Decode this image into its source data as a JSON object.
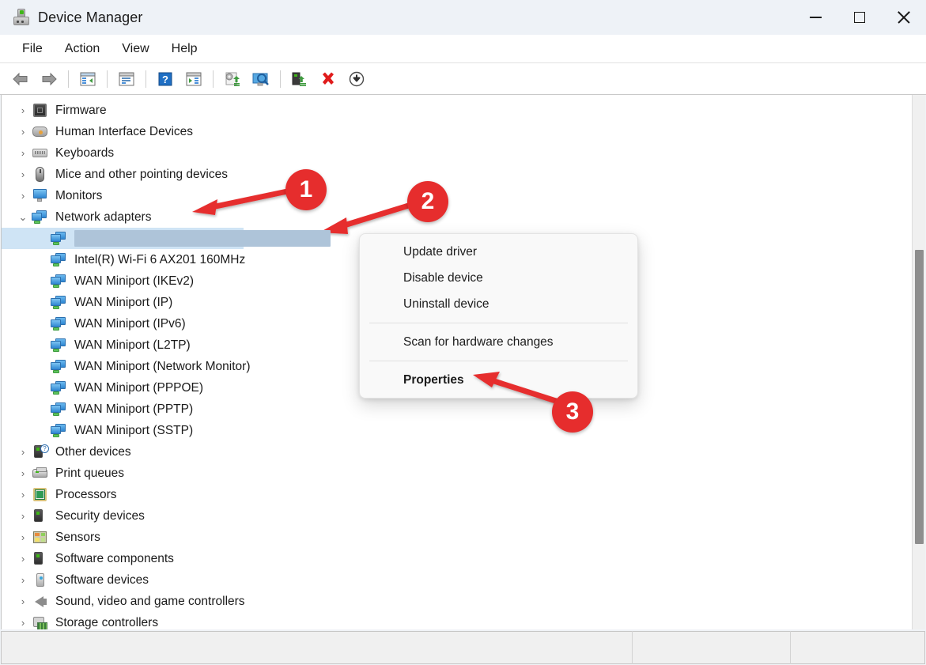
{
  "window": {
    "title": "Device Manager",
    "icon": "device-manager-icon",
    "controls": {
      "minimize": "minimize-button",
      "maximize": "maximize-button",
      "close": "close-button"
    }
  },
  "menubar": {
    "items": [
      {
        "label": "File"
      },
      {
        "label": "Action"
      },
      {
        "label": "View"
      },
      {
        "label": "Help"
      }
    ]
  },
  "toolbar": {
    "buttons": [
      {
        "name": "back-icon"
      },
      {
        "name": "forward-icon"
      },
      {
        "name": "show-hide-console-tree-icon"
      },
      {
        "name": "properties-icon"
      },
      {
        "name": "help-icon"
      },
      {
        "name": "show-hide-action-pane-icon"
      },
      {
        "name": "update-driver-icon"
      },
      {
        "name": "scan-for-hardware-changes-icon"
      },
      {
        "name": "enable-device-icon"
      },
      {
        "name": "uninstall-device-icon"
      },
      {
        "name": "download-icon"
      }
    ]
  },
  "tree": {
    "items": [
      {
        "label": "Firmware",
        "icon": "firmware-icon",
        "level": "category",
        "expanded": false
      },
      {
        "label": "Human Interface Devices",
        "icon": "hid-icon",
        "level": "category",
        "expanded": false
      },
      {
        "label": "Keyboards",
        "icon": "keyboard-icon",
        "level": "category",
        "expanded": false
      },
      {
        "label": "Mice and other pointing devices",
        "icon": "mouse-icon",
        "level": "category",
        "expanded": false
      },
      {
        "label": "Monitors",
        "icon": "monitor-icon",
        "level": "category",
        "expanded": false
      },
      {
        "label": "Network adapters",
        "icon": "network-adapter-icon",
        "level": "category",
        "expanded": true
      },
      {
        "label": "",
        "icon": "network-adapter-icon",
        "level": "child",
        "selected": true,
        "redacted": true
      },
      {
        "label": "Intel(R) Wi-Fi 6 AX201 160MHz",
        "icon": "network-adapter-icon",
        "level": "child"
      },
      {
        "label": "WAN Miniport (IKEv2)",
        "icon": "network-adapter-icon",
        "level": "child"
      },
      {
        "label": "WAN Miniport (IP)",
        "icon": "network-adapter-icon",
        "level": "child"
      },
      {
        "label": "WAN Miniport (IPv6)",
        "icon": "network-adapter-icon",
        "level": "child"
      },
      {
        "label": "WAN Miniport (L2TP)",
        "icon": "network-adapter-icon",
        "level": "child"
      },
      {
        "label": "WAN Miniport (Network Monitor)",
        "icon": "network-adapter-icon",
        "level": "child"
      },
      {
        "label": "WAN Miniport (PPPOE)",
        "icon": "network-adapter-icon",
        "level": "child"
      },
      {
        "label": "WAN Miniport (PPTP)",
        "icon": "network-adapter-icon",
        "level": "child"
      },
      {
        "label": "WAN Miniport (SSTP)",
        "icon": "network-adapter-icon",
        "level": "child"
      },
      {
        "label": "Other devices",
        "icon": "other-devices-icon",
        "level": "category",
        "expanded": false
      },
      {
        "label": "Print queues",
        "icon": "printer-icon",
        "level": "category",
        "expanded": false
      },
      {
        "label": "Processors",
        "icon": "processor-icon",
        "level": "category",
        "expanded": false
      },
      {
        "label": "Security devices",
        "icon": "security-device-icon",
        "level": "category",
        "expanded": false
      },
      {
        "label": "Sensors",
        "icon": "sensor-icon",
        "level": "category",
        "expanded": false
      },
      {
        "label": "Software components",
        "icon": "software-component-icon",
        "level": "category",
        "expanded": false
      },
      {
        "label": "Software devices",
        "icon": "software-device-icon",
        "level": "category",
        "expanded": false
      },
      {
        "label": "Sound, video and game controllers",
        "icon": "speaker-icon",
        "level": "category",
        "expanded": false
      },
      {
        "label": "Storage controllers",
        "icon": "storage-controller-icon",
        "level": "category",
        "expanded": false
      }
    ]
  },
  "context_menu": {
    "items": [
      {
        "label": "Update driver",
        "bold": false,
        "separator_after": false
      },
      {
        "label": "Disable device",
        "bold": false,
        "separator_after": false
      },
      {
        "label": "Uninstall device",
        "bold": false,
        "separator_after": true
      },
      {
        "label": "Scan for hardware changes",
        "bold": false,
        "separator_after": true
      },
      {
        "label": "Properties",
        "bold": true,
        "separator_after": false
      }
    ]
  },
  "annotations": [
    {
      "number": "1",
      "target": "network-adapters-node"
    },
    {
      "number": "2",
      "target": "selected-network-adapter-row"
    },
    {
      "number": "3",
      "target": "properties-menu-item"
    }
  ],
  "colors": {
    "annotation_red": "#e62d2d",
    "selection_blue": "#cfe4f5",
    "redaction_bar": "#aec4d9",
    "titlebar_bg": "#eef2f7",
    "menu_bg": "#f9f9f9"
  },
  "statusbar": {
    "segments": [
      "",
      "",
      ""
    ]
  },
  "scrollbar": {
    "orientation": "vertical",
    "thumb_position_pct": 29
  }
}
